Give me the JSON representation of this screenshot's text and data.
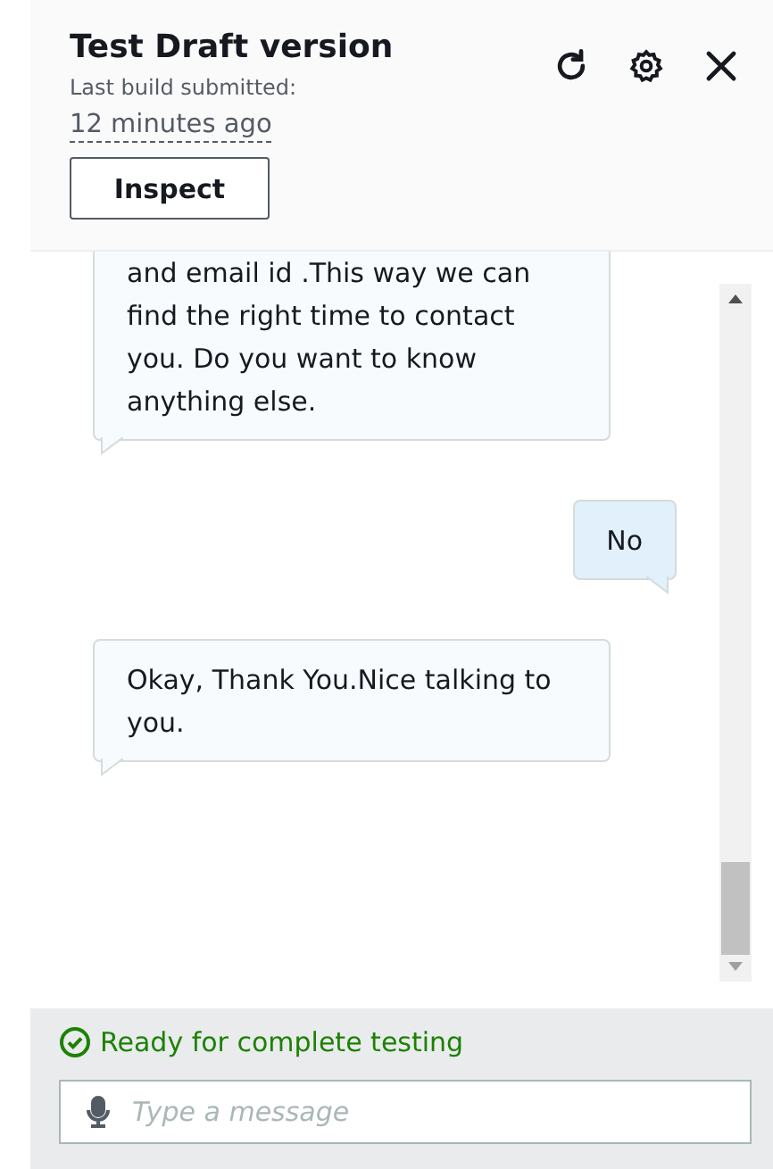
{
  "header": {
    "title": "Test Draft version",
    "subtitle": "Last build submitted:",
    "time": "12 minutes ago",
    "inspect_button": "Inspect"
  },
  "messages": [
    {
      "kind": "bot",
      "text": "and email id .This way we can find the right time to contact you. Do you want to know anything else."
    },
    {
      "kind": "user",
      "text": "No"
    },
    {
      "kind": "bot",
      "text": "Okay, Thank You.Nice talking to you."
    }
  ],
  "status": {
    "text": "Ready for complete testing"
  },
  "input": {
    "placeholder": "Type a message"
  }
}
